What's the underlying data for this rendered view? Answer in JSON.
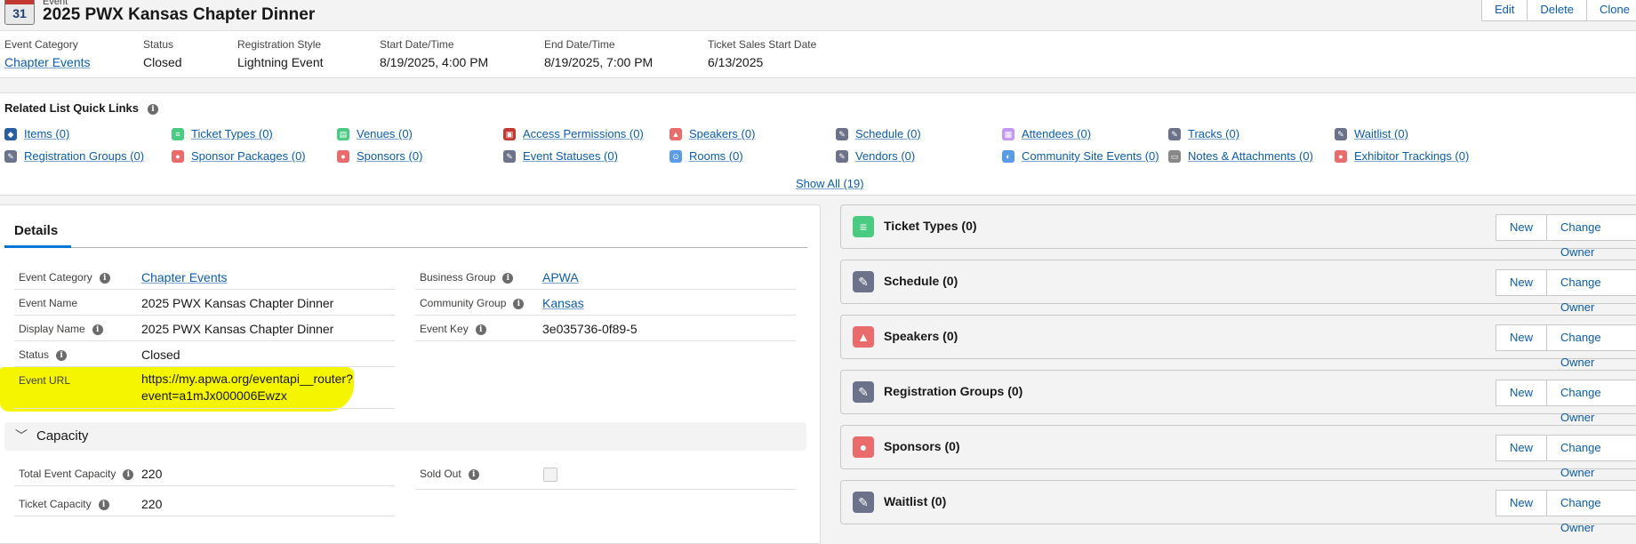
{
  "header": {
    "object_label": "Event",
    "title": "2025 PWX Kansas Chapter Dinner",
    "icon_day": "31",
    "buttons": [
      "Edit",
      "Delete",
      "Clone"
    ]
  },
  "highlights": [
    {
      "label": "Event Category",
      "value": "Chapter Events",
      "link": true
    },
    {
      "label": "Status",
      "value": "Closed",
      "link": false
    },
    {
      "label": "Registration Style",
      "value": "Lightning Event",
      "link": false
    },
    {
      "label": "Start Date/Time",
      "value": "8/19/2025, 4:00 PM",
      "link": false
    },
    {
      "label": "End Date/Time",
      "value": "8/19/2025, 7:00 PM",
      "link": false
    },
    {
      "label": "Ticket Sales Start Date",
      "value": "6/13/2025",
      "link": false
    }
  ],
  "quick_links": {
    "title": "Related List Quick Links",
    "show_all": "Show All (19)",
    "row1": [
      {
        "label": "Items (0)",
        "icon": "items-icon",
        "color": "#2a5ea3"
      },
      {
        "label": "Ticket Types (0)",
        "icon": "ticket-icon",
        "color": "#4bca81"
      },
      {
        "label": "Venues (0)",
        "icon": "venue-icon",
        "color": "#4bca81"
      },
      {
        "label": "Access Permissions (0)",
        "icon": "lock-icon",
        "color": "#c23934"
      },
      {
        "label": "Speakers (0)",
        "icon": "speaker-icon",
        "color": "#e96b6b"
      },
      {
        "label": "Schedule (0)",
        "icon": "wrench-icon",
        "color": "#6b7289"
      },
      {
        "label": "Attendees (0)",
        "icon": "attendee-icon",
        "color": "#c398f5"
      },
      {
        "label": "Tracks (0)",
        "icon": "wrench-icon",
        "color": "#6b7289"
      },
      {
        "label": "Waitlist (0)",
        "icon": "wrench-icon",
        "color": "#6b7289"
      }
    ],
    "row2": [
      {
        "label": "Registration Groups (0)",
        "icon": "wrench-icon",
        "color": "#6b7289"
      },
      {
        "label": "Sponsor Packages (0)",
        "icon": "sponsor-icon",
        "color": "#e96b6b"
      },
      {
        "label": "Sponsors (0)",
        "icon": "sponsor-icon",
        "color": "#e96b6b"
      },
      {
        "label": "Event Statuses (0)",
        "icon": "wrench-icon",
        "color": "#6b7289"
      },
      {
        "label": "Rooms (0)",
        "icon": "room-icon",
        "color": "#5a9be8"
      },
      {
        "label": "Vendors (0)",
        "icon": "wrench-icon",
        "color": "#6b7289"
      },
      {
        "label": "Community Site Events (0)",
        "icon": "community-icon",
        "color": "#5a9be8"
      },
      {
        "label": "Notes & Attachments (0)",
        "icon": "notes-icon",
        "color": "#888888"
      },
      {
        "label": "Exhibitor Trackings (0)",
        "icon": "exhibitor-icon",
        "color": "#e96b6b"
      }
    ]
  },
  "details": {
    "tab": "Details",
    "left": [
      {
        "label": "Event Category",
        "value": "Chapter Events",
        "link": true,
        "info": true
      },
      {
        "label": "Event Name",
        "value": "2025 PWX Kansas Chapter Dinner",
        "link": false,
        "info": false
      },
      {
        "label": "Display Name",
        "value": "2025 PWX Kansas Chapter Dinner",
        "link": false,
        "info": true
      },
      {
        "label": "Status",
        "value": "Closed",
        "link": false,
        "info": true
      }
    ],
    "event_url": {
      "label": "Event URL",
      "line1": "https://my.apwa.org/eventapi__router?",
      "line2": "event=a1mJx000006Ewzx"
    },
    "right": [
      {
        "label": "Business Group",
        "value": "APWA",
        "link": true,
        "info": true
      },
      {
        "label": "Community Group",
        "value": "Kansas",
        "link": true,
        "info": true
      },
      {
        "label": "Event Key",
        "value": "3e035736-0f89-5",
        "link": false,
        "info": true
      }
    ],
    "capacity": {
      "title": "Capacity",
      "total_label": "Total Event Capacity",
      "total_value": "220",
      "ticket_label": "Ticket Capacity",
      "ticket_value": "220",
      "sold_out_label": "Sold Out",
      "sold_out": false
    }
  },
  "related_cards": [
    {
      "title": "Ticket Types (0)",
      "icon": "ticket-icon",
      "color": "#4bca81"
    },
    {
      "title": "Schedule (0)",
      "icon": "wrench-icon",
      "color": "#6b7289"
    },
    {
      "title": "Speakers (0)",
      "icon": "speaker-icon",
      "color": "#e96b6b"
    },
    {
      "title": "Registration Groups (0)",
      "icon": "wrench-icon",
      "color": "#6b7289"
    },
    {
      "title": "Sponsors (0)",
      "icon": "sponsor-icon",
      "color": "#e96b6b"
    },
    {
      "title": "Waitlist (0)",
      "icon": "wrench-icon",
      "color": "#6b7289"
    }
  ],
  "card_buttons": {
    "new": "New",
    "change_owner": "Change Owner"
  }
}
